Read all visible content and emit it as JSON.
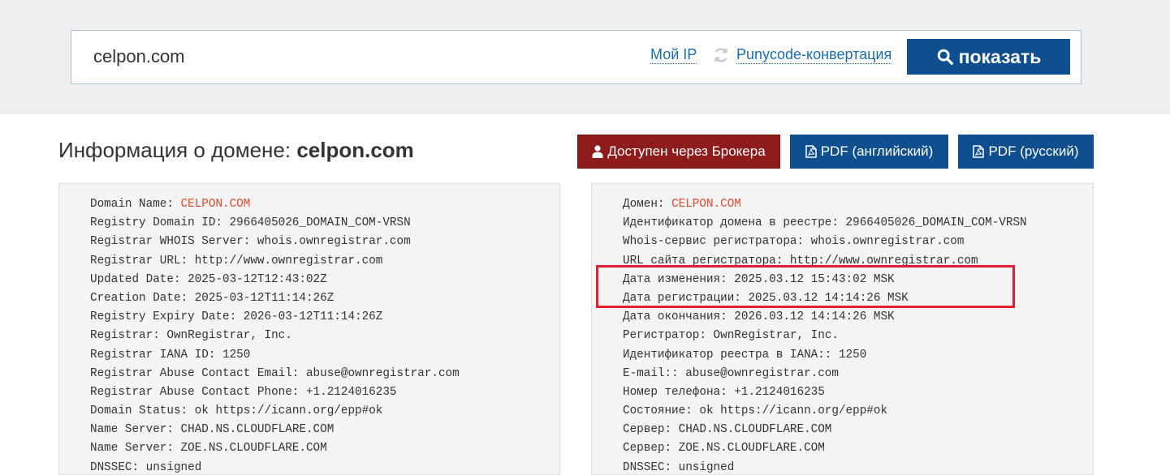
{
  "search": {
    "value": "celpon.com",
    "my_ip_label": "Мой IP",
    "punycode_label": "Punycode-конвертация",
    "show_button_label": "показать"
  },
  "page": {
    "title_prefix": "Информация о домене: ",
    "title_domain": "celpon.com"
  },
  "actions": {
    "broker_label": "Доступен через Брокера",
    "pdf_en_label": "PDF (английский)",
    "pdf_ru_label": "PDF (русский)"
  },
  "whois_en": [
    {
      "label": "Domain Name: ",
      "value": "CELPON.COM"
    },
    {
      "label": "Registry Domain ID: ",
      "value": "2966405026_DOMAIN_COM-VRSN"
    },
    {
      "label": "Registrar WHOIS Server: ",
      "value": "whois.ownregistrar.com"
    },
    {
      "label": "Registrar URL: ",
      "value": "http://www.ownregistrar.com"
    },
    {
      "label": "Updated Date: ",
      "value": "2025-03-12T12:43:02Z"
    },
    {
      "label": "Creation Date: ",
      "value": "2025-03-12T11:14:26Z"
    },
    {
      "label": "Registry Expiry Date: ",
      "value": "2026-03-12T11:14:26Z"
    },
    {
      "label": "Registrar: ",
      "value": "OwnRegistrar, Inc."
    },
    {
      "label": "Registrar IANA ID: ",
      "value": "1250"
    },
    {
      "label": "Registrar Abuse Contact Email: ",
      "value": "abuse@ownregistrar.com"
    },
    {
      "label": "Registrar Abuse Contact Phone: ",
      "value": "+1.2124016235"
    },
    {
      "label": "Domain Status: ",
      "value": "ok https://icann.org/epp#ok"
    },
    {
      "label": "Name Server: ",
      "value": "CHAD.NS.CLOUDFLARE.COM"
    },
    {
      "label": "Name Server: ",
      "value": "ZOE.NS.CLOUDFLARE.COM"
    },
    {
      "label": "DNSSEC: ",
      "value": "unsigned"
    }
  ],
  "whois_ru": [
    {
      "label": "Домен: ",
      "value": "CELPON.COM"
    },
    {
      "label": "Идентификатор домена в реестре: ",
      "value": "2966405026_DOMAIN_COM-VRSN"
    },
    {
      "label": "Whois-сервис регистратора: ",
      "value": "whois.ownregistrar.com"
    },
    {
      "label": "URL сайта регистратора: ",
      "value": "http://www.ownregistrar.com"
    },
    {
      "label": "Дата изменения: ",
      "value": "2025.03.12 15:43:02 MSK"
    },
    {
      "label": "Дата регистрации: ",
      "value": "2025.03.12 14:14:26 MSK"
    },
    {
      "label": "Дата окончания: ",
      "value": "2026.03.12 14:14:26 MSK"
    },
    {
      "label": "Регистратор: ",
      "value": "OwnRegistrar, Inc."
    },
    {
      "label": "Идентификатор реестра в IANA:: ",
      "value": "1250"
    },
    {
      "label": "E-mail:: ",
      "value": "abuse@ownregistrar.com"
    },
    {
      "label": "Номер телефона: ",
      "value": "+1.2124016235"
    },
    {
      "label": "Состояние: ",
      "value": "ok https://icann.org/epp#ok"
    },
    {
      "label": "Сервер: ",
      "value": "CHAD.NS.CLOUDFLARE.COM"
    },
    {
      "label": "Сервер: ",
      "value": "ZOE.NS.CLOUDFLARE.COM"
    },
    {
      "label": "DNSSEC: ",
      "value": "unsigned"
    }
  ],
  "colors": {
    "primary_blue": "#0f4f8f",
    "broker_red": "#8e1c1c",
    "domain_highlight": "#e04a2f",
    "annotation_box": "#e02030"
  }
}
